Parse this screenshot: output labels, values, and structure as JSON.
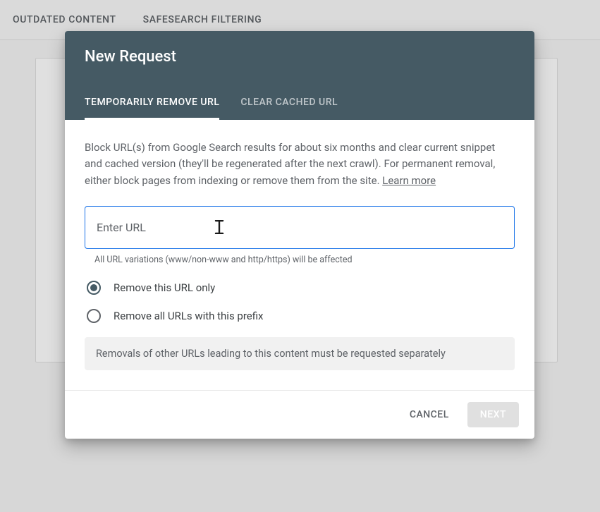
{
  "background_tabs": {
    "outdated": "OUTDATED CONTENT",
    "safesearch": "SAFESEARCH FILTERING"
  },
  "modal": {
    "title": "New Request",
    "tabs": {
      "remove": "TEMPORARILY REMOVE URL",
      "cached": "CLEAR CACHED URL"
    },
    "description": "Block URL(s) from Google Search results for about six months and clear current snippet and cached version (they'll be regenerated after the next crawl). For permanent removal, either block pages from indexing or remove them from the site. ",
    "learn_more": "Learn more",
    "url_placeholder": "Enter URL",
    "url_helper": "All URL variations (www/non-www and http/https) will be affected",
    "options": {
      "only": "Remove this URL only",
      "prefix": "Remove all URLs with this prefix"
    },
    "note": "Removals of other URLs leading to this content must be requested separately",
    "cancel": "CANCEL",
    "next": "NEXT"
  }
}
